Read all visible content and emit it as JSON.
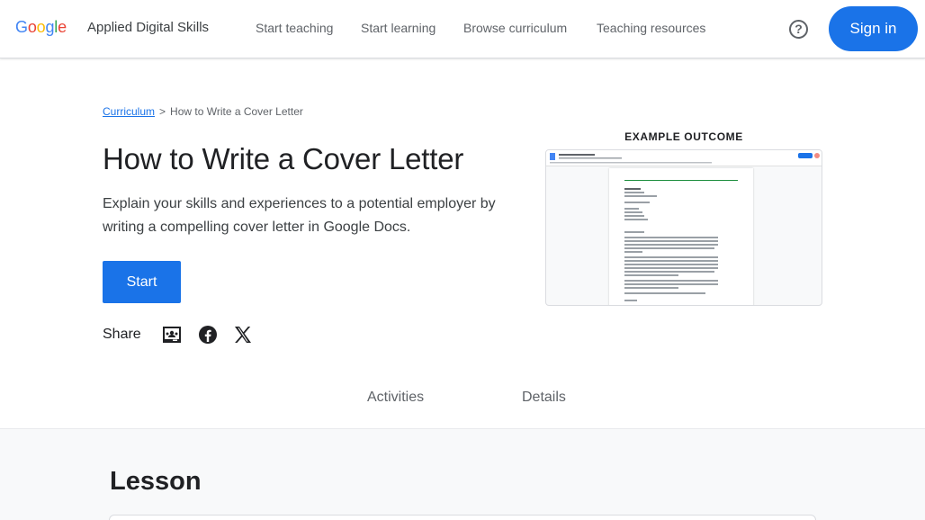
{
  "header": {
    "logo_letters": [
      "G",
      "o",
      "o",
      "g",
      "l",
      "e"
    ],
    "logo_colors": [
      "#4285F4",
      "#EA4335",
      "#FBBC05",
      "#4285F4",
      "#34A853",
      "#EA4335"
    ],
    "product_name": "Applied Digital Skills",
    "nav": [
      "Start teaching",
      "Start learning",
      "Browse curriculum",
      "Teaching resources"
    ],
    "help_icon": "?",
    "sign_in_label": "Sign in",
    "accent_color": "#1a73e8"
  },
  "hero": {
    "breadcrumb_link": "Curriculum",
    "breadcrumb_separator": ">",
    "breadcrumb_current": "How to Write a Cover Letter",
    "title": "How to Write a Cover Letter",
    "description": "Explain your skills and experiences to a potential employer by writing a compelling cover letter in Google Docs.",
    "start_label": "Start",
    "share_label": "Share",
    "share_icons": [
      "google-classroom-icon",
      "facebook-icon",
      "x-icon"
    ]
  },
  "example": {
    "label": "EXAMPLE OUTCOME"
  },
  "tabs": [
    "Activities",
    "Details"
  ],
  "lesson": {
    "heading": "Lesson"
  }
}
